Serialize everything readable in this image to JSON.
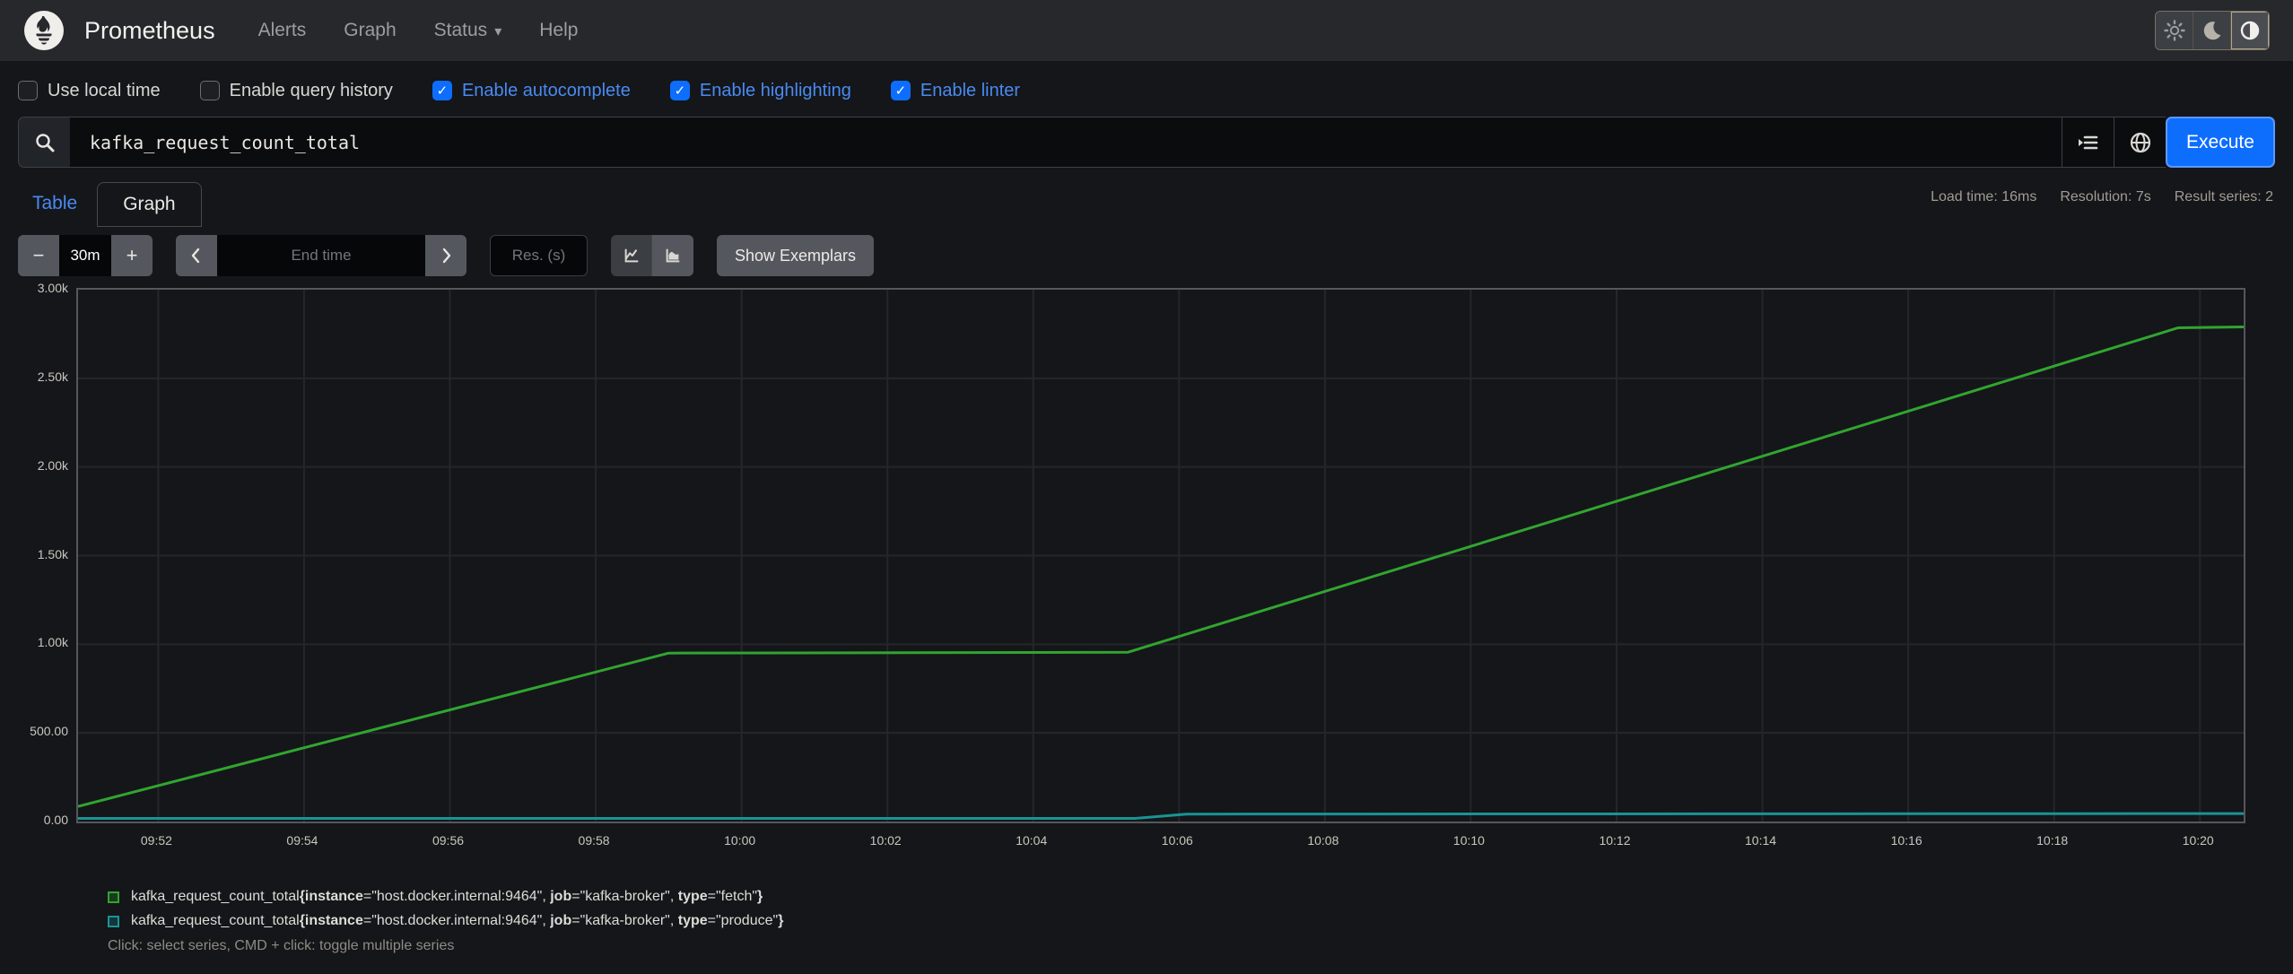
{
  "navbar": {
    "brand": "Prometheus",
    "items": [
      {
        "label": "Alerts",
        "dropdown": false
      },
      {
        "label": "Graph",
        "dropdown": false
      },
      {
        "label": "Status",
        "dropdown": true
      },
      {
        "label": "Help",
        "dropdown": false
      }
    ],
    "theme_buttons": [
      "light-theme",
      "dark-theme",
      "auto-theme"
    ],
    "active_theme": "auto-theme"
  },
  "options": [
    {
      "label": "Use local time",
      "checked": false
    },
    {
      "label": "Enable query history",
      "checked": false
    },
    {
      "label": "Enable autocomplete",
      "checked": true
    },
    {
      "label": "Enable highlighting",
      "checked": true
    },
    {
      "label": "Enable linter",
      "checked": true
    }
  ],
  "query": {
    "value": "kafka_request_count_total",
    "execute_label": "Execute"
  },
  "tabs": {
    "table": "Table",
    "graph": "Graph",
    "active": "Graph"
  },
  "stats": {
    "load_time": "Load time: 16ms",
    "resolution": "Resolution: 7s",
    "result_series": "Result series: 2"
  },
  "controls": {
    "range_value": "30m",
    "end_time_placeholder": "End time",
    "res_placeholder": "Res. (s)",
    "show_exemplars_label": "Show Exemplars"
  },
  "icons": {
    "check": "✓",
    "caret": "▾",
    "minus": "−",
    "plus": "+"
  },
  "chart_data": {
    "type": "line",
    "title": "kafka_request_count_total",
    "x_domain_minutes_from_0950": [
      0.9,
      30.6
    ],
    "y_domain": [
      0,
      3000
    ],
    "grid": true,
    "x_ticks": [
      {
        "t": 2,
        "label": "09:52"
      },
      {
        "t": 4,
        "label": "09:54"
      },
      {
        "t": 6,
        "label": "09:56"
      },
      {
        "t": 8,
        "label": "09:58"
      },
      {
        "t": 10,
        "label": "10:00"
      },
      {
        "t": 12,
        "label": "10:02"
      },
      {
        "t": 14,
        "label": "10:04"
      },
      {
        "t": 16,
        "label": "10:06"
      },
      {
        "t": 18,
        "label": "10:08"
      },
      {
        "t": 20,
        "label": "10:10"
      },
      {
        "t": 22,
        "label": "10:12"
      },
      {
        "t": 24,
        "label": "10:14"
      },
      {
        "t": 26,
        "label": "10:16"
      },
      {
        "t": 28,
        "label": "10:18"
      },
      {
        "t": 30,
        "label": "10:20"
      }
    ],
    "y_ticks": [
      {
        "v": 0,
        "label": "0.00"
      },
      {
        "v": 500,
        "label": "500.00"
      },
      {
        "v": 1000,
        "label": "1.00k"
      },
      {
        "v": 1500,
        "label": "1.50k"
      },
      {
        "v": 2000,
        "label": "2.00k"
      },
      {
        "v": 2500,
        "label": "2.50k"
      },
      {
        "v": 3000,
        "label": "3.00k"
      }
    ],
    "series": [
      {
        "name": "kafka_request_count_total{type=\"fetch\"}",
        "color": "#31a52f",
        "points": [
          [
            0.9,
            85
          ],
          [
            9.0,
            950
          ],
          [
            15.3,
            955
          ],
          [
            29.7,
            2785
          ],
          [
            30.6,
            2790
          ]
        ]
      },
      {
        "name": "kafka_request_count_total{type=\"produce\"}",
        "color": "#1a9494",
        "points": [
          [
            0.9,
            18
          ],
          [
            15.4,
            18
          ],
          [
            16.1,
            42
          ],
          [
            30.6,
            45
          ]
        ]
      }
    ],
    "colors": {
      "grid": "#24262b",
      "border": "#55575b",
      "axis_text": "#cac6bd"
    }
  },
  "legend": {
    "items": [
      {
        "color": "#31a52f",
        "metric": "kafka_request_count_total",
        "labels": [
          {
            "name": "instance",
            "value": "host.docker.internal:9464"
          },
          {
            "name": "job",
            "value": "kafka-broker"
          },
          {
            "name": "type",
            "value": "fetch"
          }
        ]
      },
      {
        "color": "#1a9494",
        "metric": "kafka_request_count_total",
        "labels": [
          {
            "name": "instance",
            "value": "host.docker.internal:9464"
          },
          {
            "name": "job",
            "value": "kafka-broker"
          },
          {
            "name": "type",
            "value": "produce"
          }
        ]
      }
    ]
  },
  "hint": "Click: select series, CMD + click: toggle multiple series"
}
